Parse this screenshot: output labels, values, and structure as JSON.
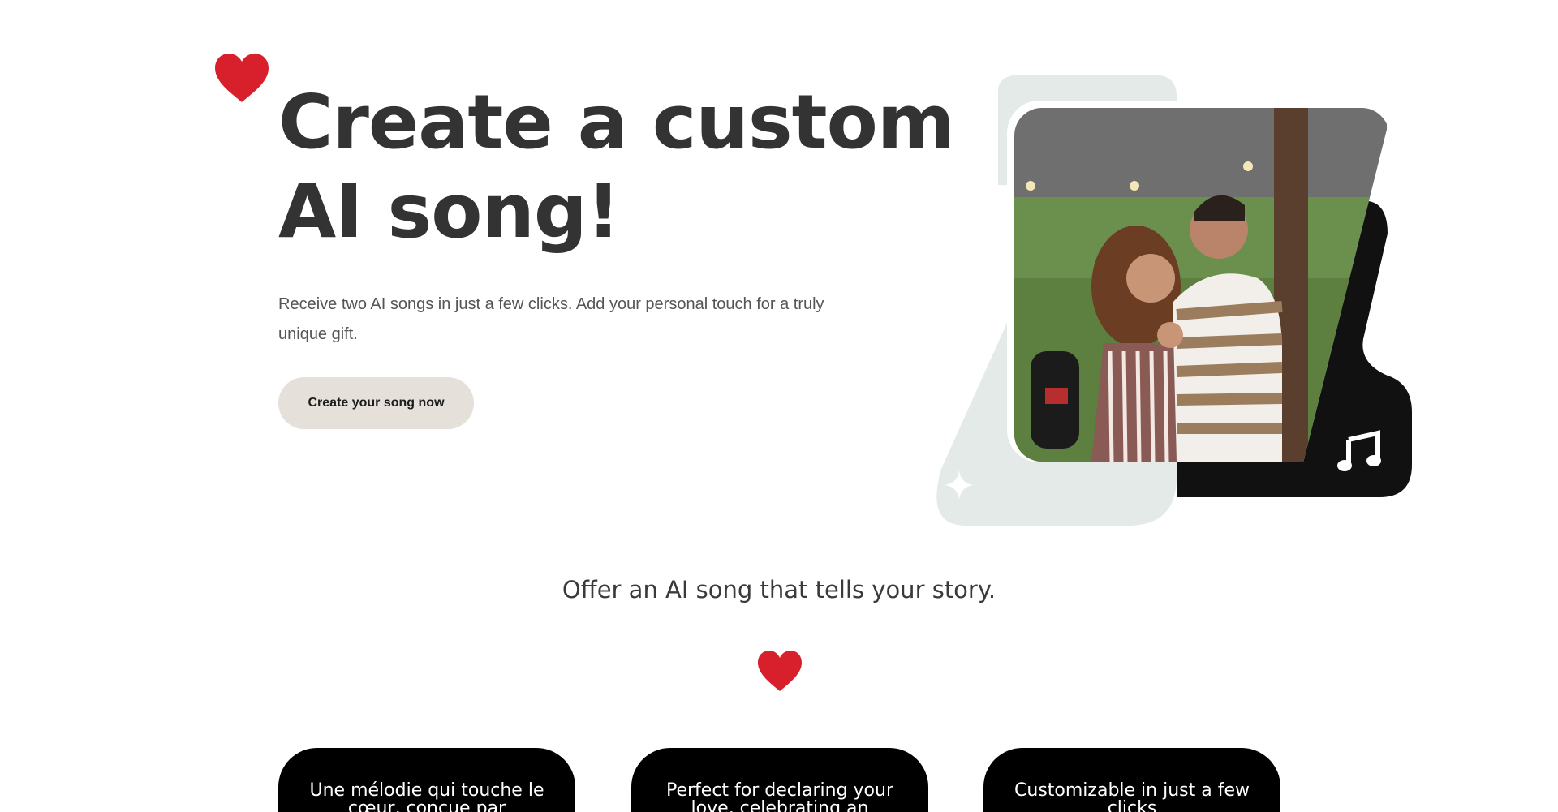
{
  "colors": {
    "heart": "#d7202c",
    "title": "#333333",
    "button_bg": "#e5e1da",
    "art_light": "#e4eae8",
    "art_dark": "#111111",
    "card_bg": "#000000"
  },
  "icons": {
    "hero_heart": "heart-icon",
    "section_heart": "heart-icon",
    "music": "music-note-icon",
    "sparkle": "sparkle-icon"
  },
  "hero": {
    "title_line1": "Create a custom",
    "title_line2": "AI song!",
    "description": "Receive two AI songs in just a few clicks. Add your personal touch for a truly unique gift.",
    "cta_label": "Create your song now"
  },
  "section": {
    "title": "Offer an AI song that tells your story."
  },
  "features": [
    {
      "text": "Une mélodie qui touche le cœur, conçue par"
    },
    {
      "text": "Perfect for declaring your love, celebrating an"
    },
    {
      "text": "Customizable in just a few clicks"
    }
  ]
}
